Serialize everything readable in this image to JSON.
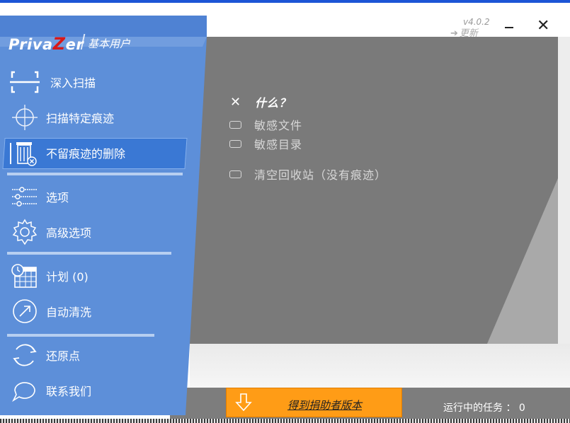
{
  "app": {
    "logo_prefix": "Priva",
    "logo_z": "Z",
    "logo_suffix": "er",
    "user_type": "基本用户",
    "version": "v4.0.2",
    "update_label": "更新"
  },
  "sidebar": {
    "items": [
      {
        "label": "深入扫描",
        "icon": "scan-frame-icon"
      },
      {
        "label": "扫描特定痕迹",
        "icon": "crosshair-icon"
      },
      {
        "label": "不留痕迹的删除",
        "icon": "trash-shred-icon",
        "active": true
      },
      {
        "label": "选项",
        "icon": "sliders-icon"
      },
      {
        "label": "高级选项",
        "icon": "gear-icon"
      },
      {
        "label": "计划 (0)",
        "icon": "calendar-clock-icon"
      },
      {
        "label": "自动清洗",
        "icon": "arrow-circle-icon"
      },
      {
        "label": "还原点",
        "icon": "restore-cycle-icon"
      },
      {
        "label": "联系我们",
        "icon": "chat-bubble-icon"
      }
    ]
  },
  "content": {
    "title": "什么？",
    "options": [
      {
        "label": "敏感文件",
        "checked": false
      },
      {
        "label": "敏感目录",
        "checked": false
      },
      {
        "label": "清空回收站（没有痕迹）",
        "checked": false
      }
    ]
  },
  "footer": {
    "donor_label": "得到捐助者版本",
    "task_status": "运行中的任务 ： 0"
  },
  "colors": {
    "sidebar_blue": "#5d8fd9",
    "active_blue": "#3a78d4",
    "content_grey": "#7a7a7a",
    "donor_orange": "#ff9c16",
    "logo_red": "#d81818"
  }
}
